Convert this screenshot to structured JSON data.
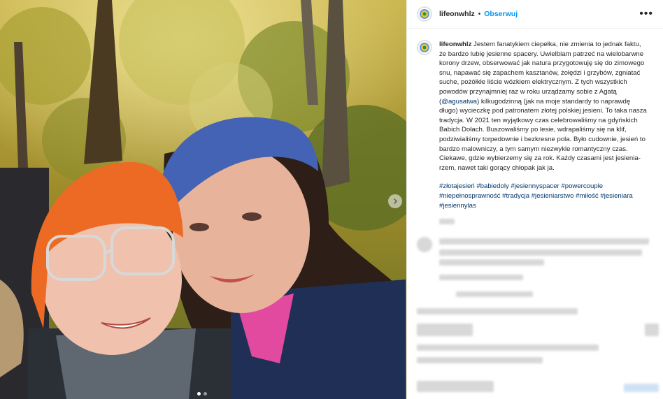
{
  "post": {
    "username": "lifeonwhlz",
    "separator": "•",
    "follow_label": "Obserwuj",
    "more_label": "•••",
    "caption_username": "lifeonwhlz",
    "caption_part1": "Jestem fanatykiem ciepełka, nie zmienia to jednak faktu, że bardzo lubię jesienne spacery. Uwielbiam patrzeć na wielobarwne korony drzew, obserwować jak natura przygotowuję się do zimowego snu, napawać się zapachem kasztanów, żołędzi i grzybów, zgniatać suche, pożółkłe liście wózkiem elektrycznym. Z tych wszystkich powodów przynajmniej raz w roku urządzamy sobie z Agatą (",
    "mention": "@agusatwa",
    "caption_part2": ") kilkugodzinną (jak na moje standardy to naprawdę długo) wycieczkę pod patronatem złotej polskiej jesieni. To taka nasza tradycja. W 2021 ten wyjątkowy czas celebrowaliśmy na gdyńskich Babich Dołach. Buszowaliśmy po lesie, wdrapaliśmy się na klif, podziwialiśmy torpedownie i bezkresne pola. Było cudownie, jesień to bardzo malowniczy, a tym samym niezwykle romantyczny czas. Ciekawe, gdzie wybierzemy się za rok. Każdy czasami jest jesienia­rzem, nawet taki gorący chłopak jak ja.",
    "hashtags": "#złotajesień #babiedoly #jesiennyspacer #powercouple #niepełnosprawność #tradycja #jesieniarstwo #miłość #jesieniara #jesiennylas"
  },
  "colors": {
    "accent": "#0095f6",
    "mention": "#00376b",
    "text": "#262626"
  },
  "icons": {
    "avatar": "avatar-icon",
    "next": "chevron-right-icon",
    "more": "more-horizontal-icon"
  },
  "carousel": {
    "dots": 2,
    "active_index": 0
  }
}
